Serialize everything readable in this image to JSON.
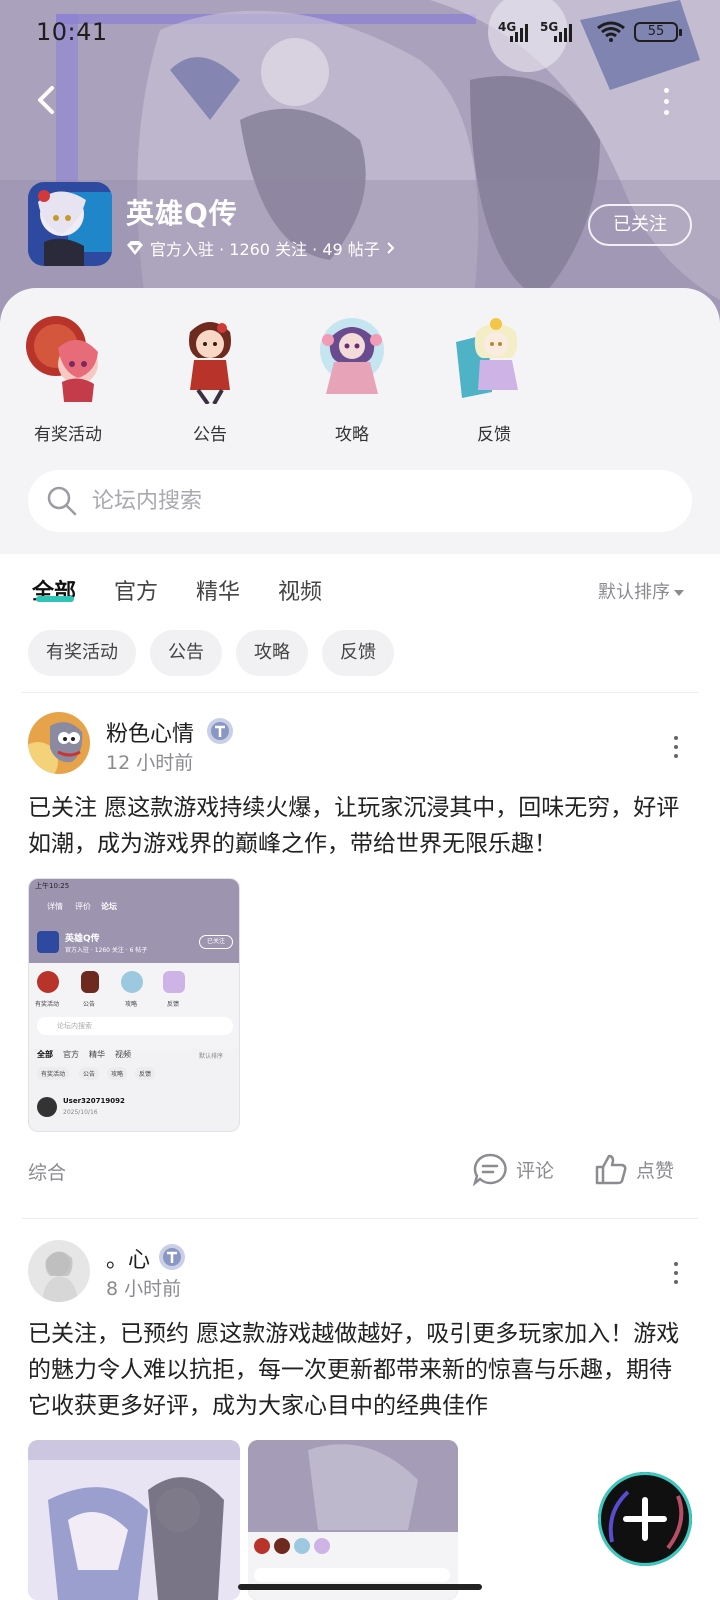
{
  "status_bar": {
    "time": "10:41",
    "network1": "4G",
    "network2": "5G",
    "battery": "55"
  },
  "header": {
    "title": "英雄Q传",
    "meta": "官方入驻 · 1260 关注 · 49 帖子",
    "follow_label": "已关注"
  },
  "categories": [
    {
      "label": "有奖活动",
      "icon": "event-character-icon"
    },
    {
      "label": "公告",
      "icon": "notice-character-icon"
    },
    {
      "label": "攻略",
      "icon": "guide-character-icon"
    },
    {
      "label": "反馈",
      "icon": "feedback-character-icon"
    }
  ],
  "search": {
    "placeholder": "论坛内搜索"
  },
  "tabs": [
    "全部",
    "官方",
    "精华",
    "视频"
  ],
  "active_tab": "全部",
  "sort": {
    "label": "默认排序"
  },
  "chips": [
    "有奖活动",
    "公告",
    "攻略",
    "反馈"
  ],
  "posts": [
    {
      "author": "粉色心情",
      "time": "12 小时前",
      "text": "已关注 愿这款游戏持续火爆，让玩家沉浸其中，回味无穷，好评如潮，成为游戏界的巅峰之作，带给世界无限乐趣！",
      "tag": "综合",
      "comment_label": "评论",
      "like_label": "点赞",
      "thumbnail": {
        "status_time": "上午10:25",
        "nav": [
          "详情",
          "评价",
          "论坛"
        ],
        "title": "英雄Q传",
        "meta": "官方入驻 · 1260 关注 · 6 帖子",
        "follow": "已关注",
        "cats": [
          "有奖活动",
          "公告",
          "攻略",
          "反馈"
        ],
        "search": "论坛内搜索",
        "tabs": [
          "全部",
          "官方",
          "精华",
          "视频"
        ],
        "sort": "默认排序",
        "chips": [
          "有奖活动",
          "公告",
          "攻略",
          "反馈"
        ],
        "user": "User320719092",
        "date": "2025/10/16"
      }
    },
    {
      "author": "。心",
      "time": "8 小时前",
      "text": "已关注，已预约 愿这款游戏越做越好，吸引更多玩家加入！游戏的魅力令人难以抗拒，每一次更新都带来新的惊喜与乐趣，期待它收获更多好评，成为大家心目中的经典佳作"
    }
  ],
  "colors": {
    "accent": "#2ec4b6",
    "header_bg": "#a79fb9",
    "panel_bg": "#f4f4f6"
  }
}
